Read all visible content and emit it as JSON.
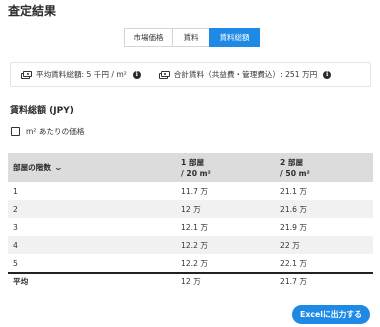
{
  "header": {
    "title": "査定結果"
  },
  "tabs": [
    {
      "label": "市場価格",
      "active": false
    },
    {
      "label": "賃料",
      "active": false
    },
    {
      "label": "賃料総額",
      "active": true
    }
  ],
  "info": {
    "avg_rent": "平均賃料総額: 5 千円 / m²",
    "total_rent": "合計賃料（共益費・管理費込）: 251 万円"
  },
  "section": {
    "title": "賃料総額 (JPY)"
  },
  "checkbox": {
    "label": "m² あたりの価格",
    "checked": false
  },
  "table": {
    "col0": "部屋の階数",
    "col1_line1": "1 部屋",
    "col1_line2": "/ 20 m²",
    "col2_line1": "2 部屋",
    "col2_line2": "/ 50 m²",
    "rows": [
      {
        "floor": "1",
        "r1": "11.7 万",
        "r2": "21.1 万"
      },
      {
        "floor": "2",
        "r1": "12 万",
        "r2": "21.6 万"
      },
      {
        "floor": "3",
        "r1": "12.1 万",
        "r2": "21.9 万"
      },
      {
        "floor": "4",
        "r1": "12.2 万",
        "r2": "22 万"
      },
      {
        "floor": "5",
        "r1": "12.2 万",
        "r2": "22.1 万"
      }
    ],
    "avg": {
      "label": "平均",
      "r1": "12 万",
      "r2": "21.7 万"
    }
  },
  "export_button": "Excelに出力する",
  "colors": {
    "accent": "#1f8ae6",
    "header_bg": "#dcdcdc",
    "stripe": "#f1f1f1"
  }
}
